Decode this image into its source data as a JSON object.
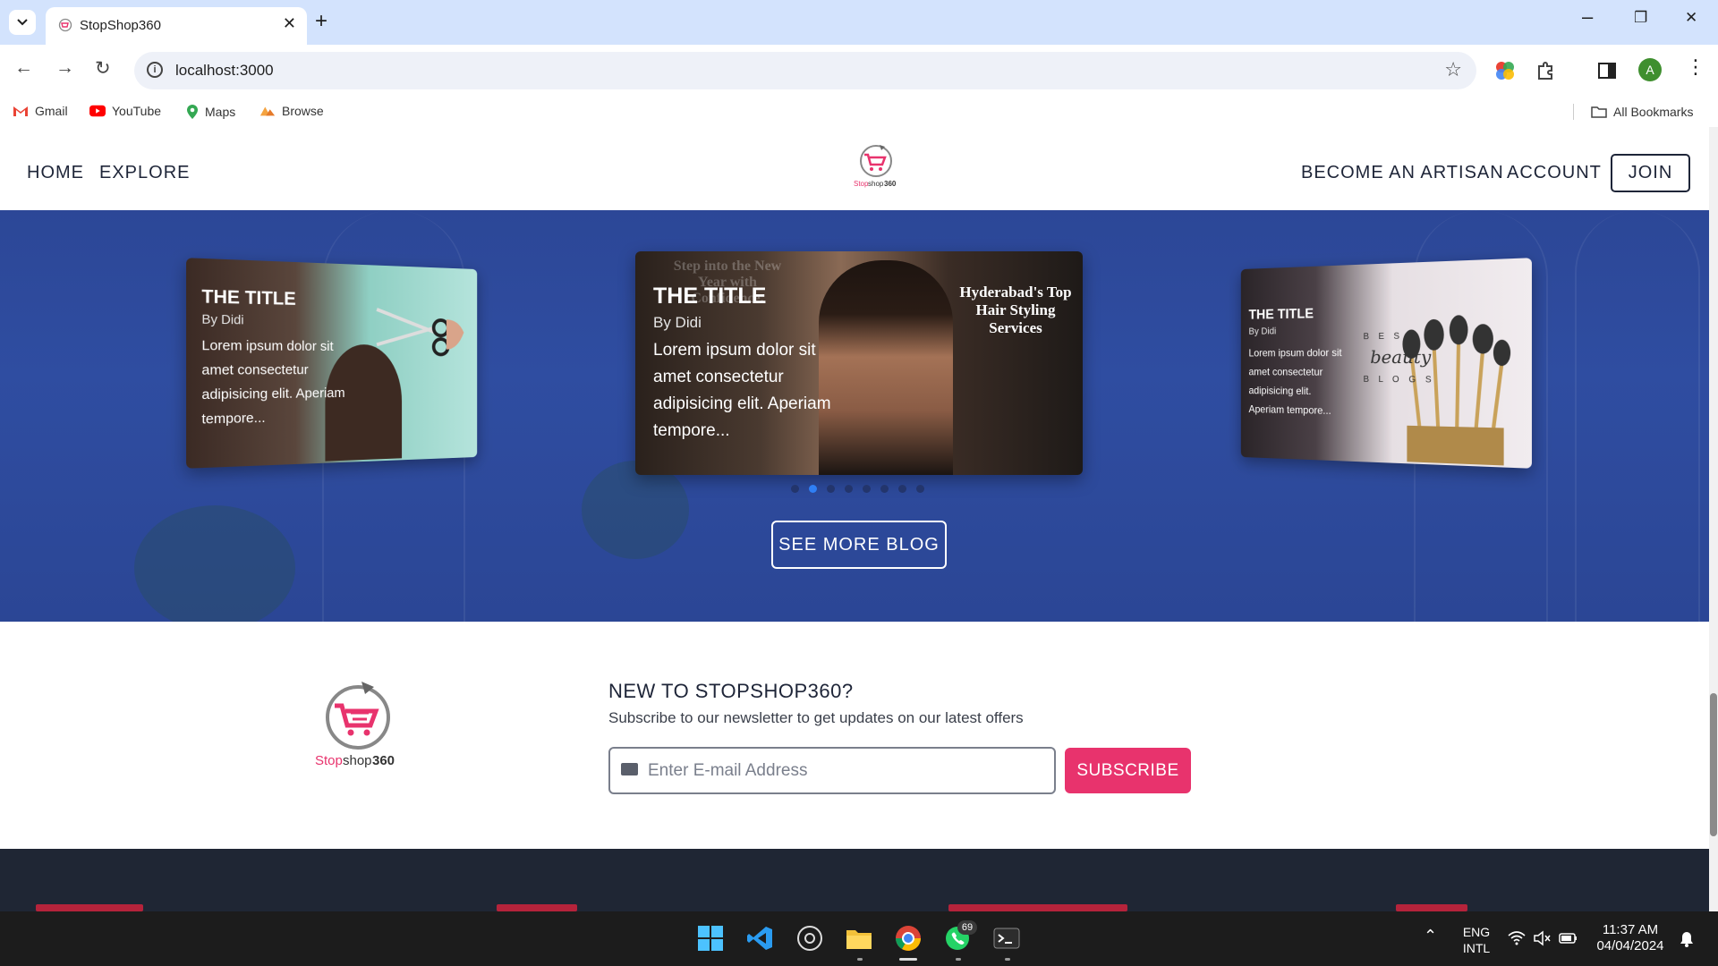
{
  "browser": {
    "tab_title": "StopShop360",
    "url": "localhost:3000",
    "profile_initial": "A",
    "bookmarks": [
      "Gmail",
      "YouTube",
      "Maps",
      "Browse"
    ],
    "all_bookmarks": "All Bookmarks"
  },
  "site": {
    "nav_left": [
      "HOME",
      "EXPLORE"
    ],
    "nav_right": [
      "BECOME AN ARTISAN",
      "ACCOUNT"
    ],
    "join_label": "JOIN",
    "logo_text": "Stopshop360"
  },
  "carousel": {
    "cards": [
      {
        "title": "THE TITLE",
        "author": "By Didi",
        "excerpt": "Lorem ipsum dolor sit amet consectetur adipisicing elit. Aperiam tempore..."
      },
      {
        "title": "THE TITLE",
        "author": "By Didi",
        "excerpt": "Lorem ipsum dolor sit amet consectetur adipisicing elit. Aperiam tempore...",
        "overlay": "Hyderabad's Top Hair Styling Services",
        "faded_text": "Step into the New Year with Confidence."
      },
      {
        "title": "THE TITLE",
        "author": "By Didi",
        "excerpt": "Lorem ipsum dolor sit amet consectetur adipisicing elit. Aperiam tempore...",
        "overlay_top": "B E S T",
        "overlay_mid": "beauty",
        "overlay_bottom": "B L O G S"
      }
    ],
    "dot_count": 8,
    "active_dot": 1,
    "see_more_label": "SEE MORE BLOG"
  },
  "newsletter": {
    "heading": "NEW TO STOPSHOP360?",
    "subtext": "Subscribe to our newsletter to get updates on our latest offers",
    "email_placeholder": "Enter E-mail Address",
    "subscribe_label": "SUBSCRIBE",
    "logo_text": "Stopshop360"
  },
  "taskbar": {
    "whatsapp_badge": "69",
    "lang_top": "ENG",
    "lang_bottom": "INTL",
    "time": "11:37 AM",
    "date": "04/04/2024"
  },
  "colors": {
    "hero_blue": "#2f4da1",
    "brand_pink": "#e8336d",
    "footer_dark": "#1f2634"
  }
}
